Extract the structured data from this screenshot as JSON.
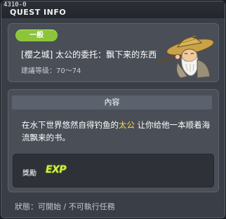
{
  "window": {
    "quest_id": "4310-0",
    "title": "QUEST INFO"
  },
  "quest": {
    "category": "一般",
    "name": "[櫻之城] 太公的委托：飘下来的东西",
    "level_label": "建議等级：70～74",
    "npc_icon": "old-fisherman-npc-portrait"
  },
  "content": {
    "header": "內容",
    "text_before": "在水下世界悠然自得钓鱼的",
    "npc_name": "太公",
    "text_after": " 让你给他一本顺着海流飘来的书。"
  },
  "reward": {
    "label": "獎勵",
    "exp_icon_text": "EXP"
  },
  "status": {
    "text": "狀態：可開始 / 不可執行任務"
  },
  "colors": {
    "category_badge": "#8cc43a",
    "npc_highlight": "#ffd84a",
    "exp_fill": "#dfe94a"
  }
}
